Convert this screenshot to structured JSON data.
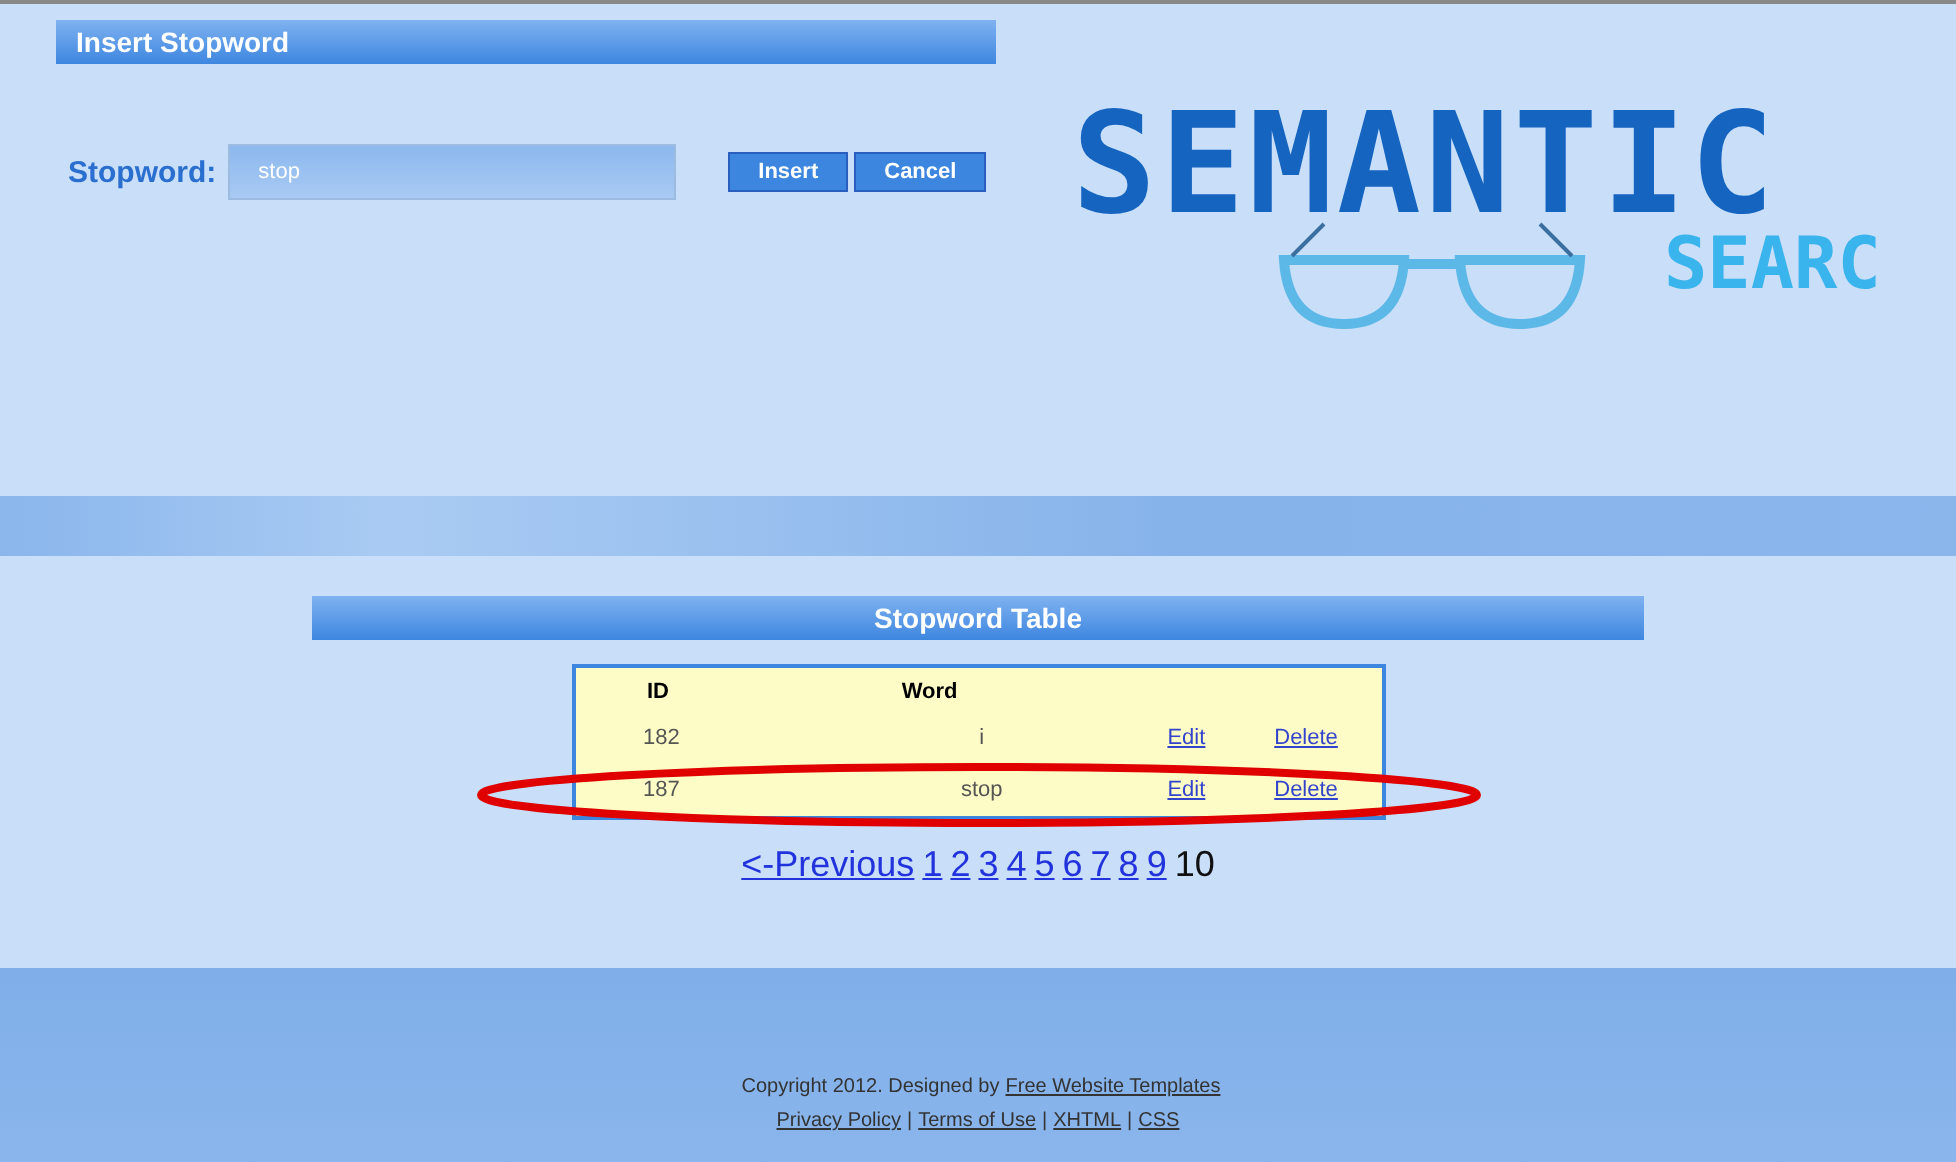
{
  "insert_panel": {
    "title": "Insert Stopword",
    "label": "Stopword:",
    "value": "stop",
    "buttons": [
      "Insert",
      "Cancel"
    ]
  },
  "logo": {
    "title": "SEMANTIC",
    "subtitle": "SEARC"
  },
  "table_panel": {
    "title": "Stopword Table"
  },
  "table": {
    "columns": [
      "ID",
      "Word"
    ],
    "rows": [
      {
        "id": "182",
        "word": "i",
        "edit": "Edit",
        "delete": "Delete",
        "highlighted": false
      },
      {
        "id": "187",
        "word": "stop",
        "edit": "Edit",
        "delete": "Delete",
        "highlighted": true
      }
    ]
  },
  "pagination": {
    "previous": "<-Previous",
    "pages": [
      {
        "label": "1",
        "current": false
      },
      {
        "label": "2",
        "current": false
      },
      {
        "label": "3",
        "current": false
      },
      {
        "label": "4",
        "current": false
      },
      {
        "label": "5",
        "current": false
      },
      {
        "label": "6",
        "current": false
      },
      {
        "label": "7",
        "current": false
      },
      {
        "label": "8",
        "current": false
      },
      {
        "label": "9",
        "current": false
      },
      {
        "label": "10",
        "current": true
      }
    ]
  },
  "footer": {
    "copyright": "Copyright 2012. Designed by",
    "designer_link": "Free Website Templates",
    "links": [
      "Privacy Policy",
      "Terms of Use",
      "XHTML",
      "CSS"
    ],
    "separator": "|"
  }
}
